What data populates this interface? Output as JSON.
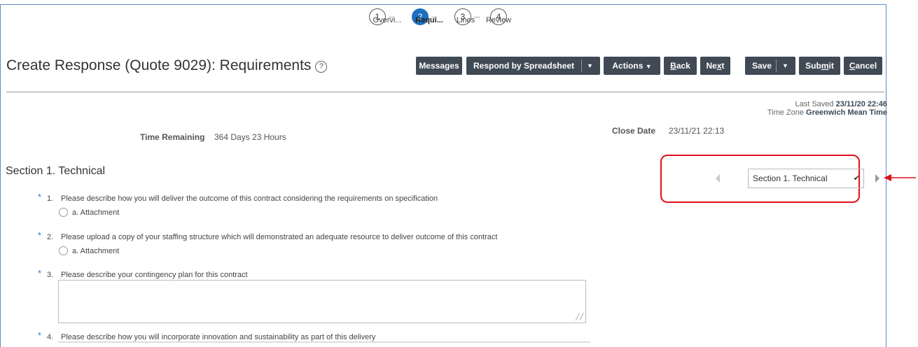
{
  "train": {
    "steps": [
      {
        "num": "1",
        "label": "Overvi..."
      },
      {
        "num": "2",
        "label": "Requi..."
      },
      {
        "num": "3",
        "label": "Lines"
      },
      {
        "num": "4",
        "label": "Review"
      }
    ],
    "active_index": 1
  },
  "page": {
    "title": "Create Response (Quote 9029): Requirements",
    "help_glyph": "?"
  },
  "toolbar": {
    "messages": "Messages",
    "respond_by_spreadsheet": "Respond by Spreadsheet",
    "actions": "Actions",
    "back_prefix": "",
    "back_u": "B",
    "back_rest": "ack",
    "next_prefix": "Ne",
    "next_u": "x",
    "next_rest": "t",
    "save": "Save",
    "submit_prefix": "Sub",
    "submit_u": "m",
    "submit_rest": "it",
    "cancel_prefix": "",
    "cancel_u": "C",
    "cancel_rest": "ancel"
  },
  "status": {
    "last_saved_label": "Last Saved",
    "last_saved_value": "23/11/20 22:46",
    "time_zone_label": "Time Zone",
    "time_zone_value": "Greenwich Mean Time"
  },
  "info": {
    "time_remaining_label": "Time Remaining",
    "time_remaining_value": "364 Days 23 Hours",
    "close_date_label": "Close Date",
    "close_date_value": "23/11/21 22:13"
  },
  "section": {
    "title": "Section 1. Technical",
    "selector_value": "Section 1. Technical"
  },
  "questions": [
    {
      "num": "1.",
      "text": "Please describe how you will deliver the outcome of this contract considering the requirements on specification",
      "option": "a. Attachment"
    },
    {
      "num": "2.",
      "text": "Please upload a copy of your staffing structure which will demonstrated an adequate resource to deliver outcome of this contract",
      "option": "a. Attachment"
    },
    {
      "num": "3.",
      "text": "Please describe your contingency plan for this contract"
    },
    {
      "num": "4.",
      "text": "Please describe how you will incorporate innovation and sustainability as part of this delivery"
    }
  ],
  "colors": {
    "active_step": "#1e6fbf",
    "button_bg": "#404a55",
    "annotation": "#e0101a",
    "required_star": "#3d7bc4"
  }
}
